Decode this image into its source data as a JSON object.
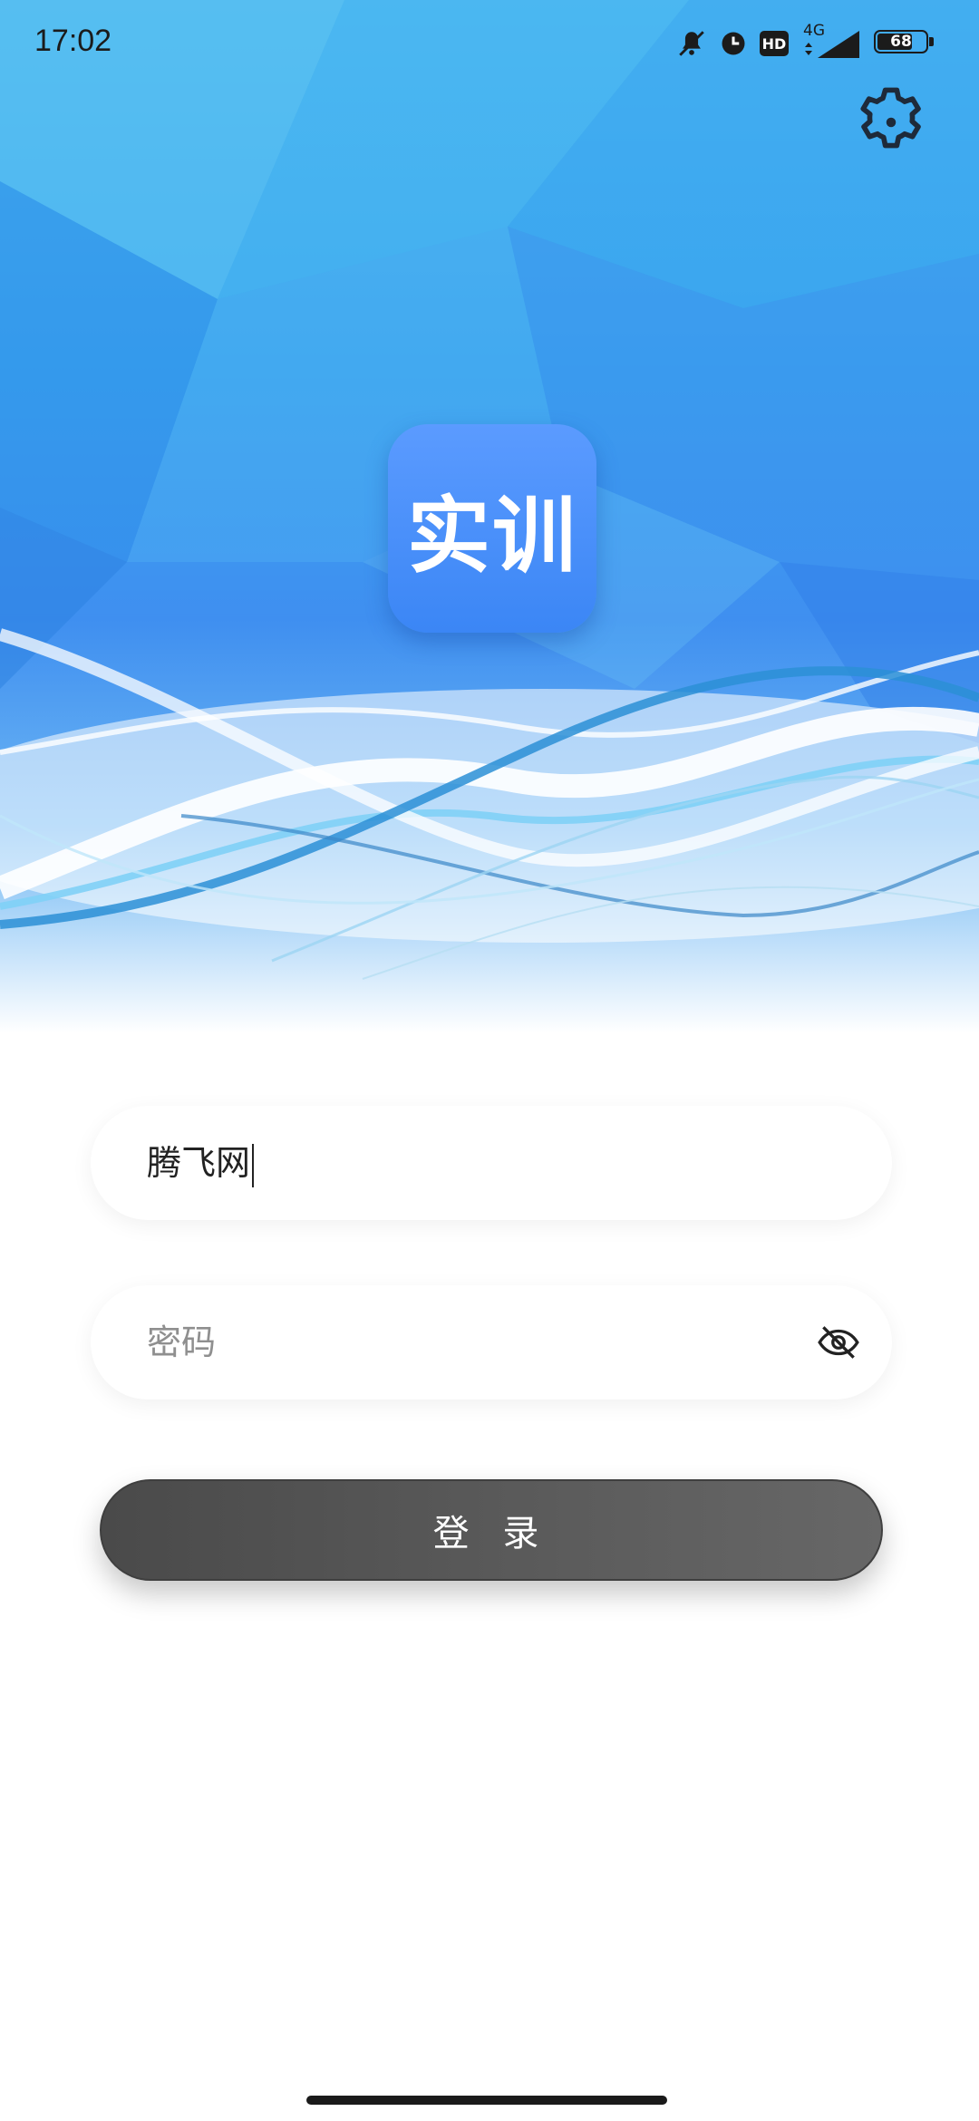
{
  "status_bar": {
    "time": "17:02",
    "network": "4G",
    "hd": "HD",
    "battery": "68",
    "icons": [
      "mute-icon",
      "alarm-icon",
      "hd-icon",
      "signal-icon",
      "battery-icon"
    ]
  },
  "header": {
    "settings_icon": "gear-icon"
  },
  "logo": {
    "text": "实训",
    "color": "#4a8ff7"
  },
  "login_form": {
    "username": {
      "value": "腾飞网"
    },
    "password": {
      "placeholder": "密码",
      "value": "",
      "visibility_icon": "eye-off-icon"
    },
    "submit_label": "登 录"
  }
}
